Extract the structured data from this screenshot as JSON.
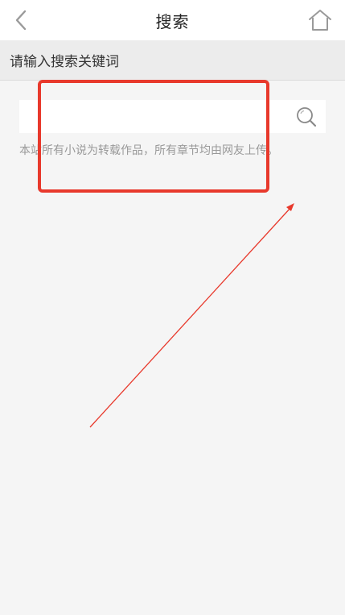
{
  "navbar": {
    "back_icon": "chevron-left-icon",
    "title": "搜索",
    "home_icon": "home-icon"
  },
  "prompt": {
    "label": "请输入搜索关键词"
  },
  "search": {
    "value": "",
    "placeholder": "",
    "button_icon": "search-icon"
  },
  "notice": {
    "text": "本站所有小说为转载作品，所有章节均由网友上传。"
  },
  "annotations": {
    "highlight_color": "#e8392c"
  }
}
